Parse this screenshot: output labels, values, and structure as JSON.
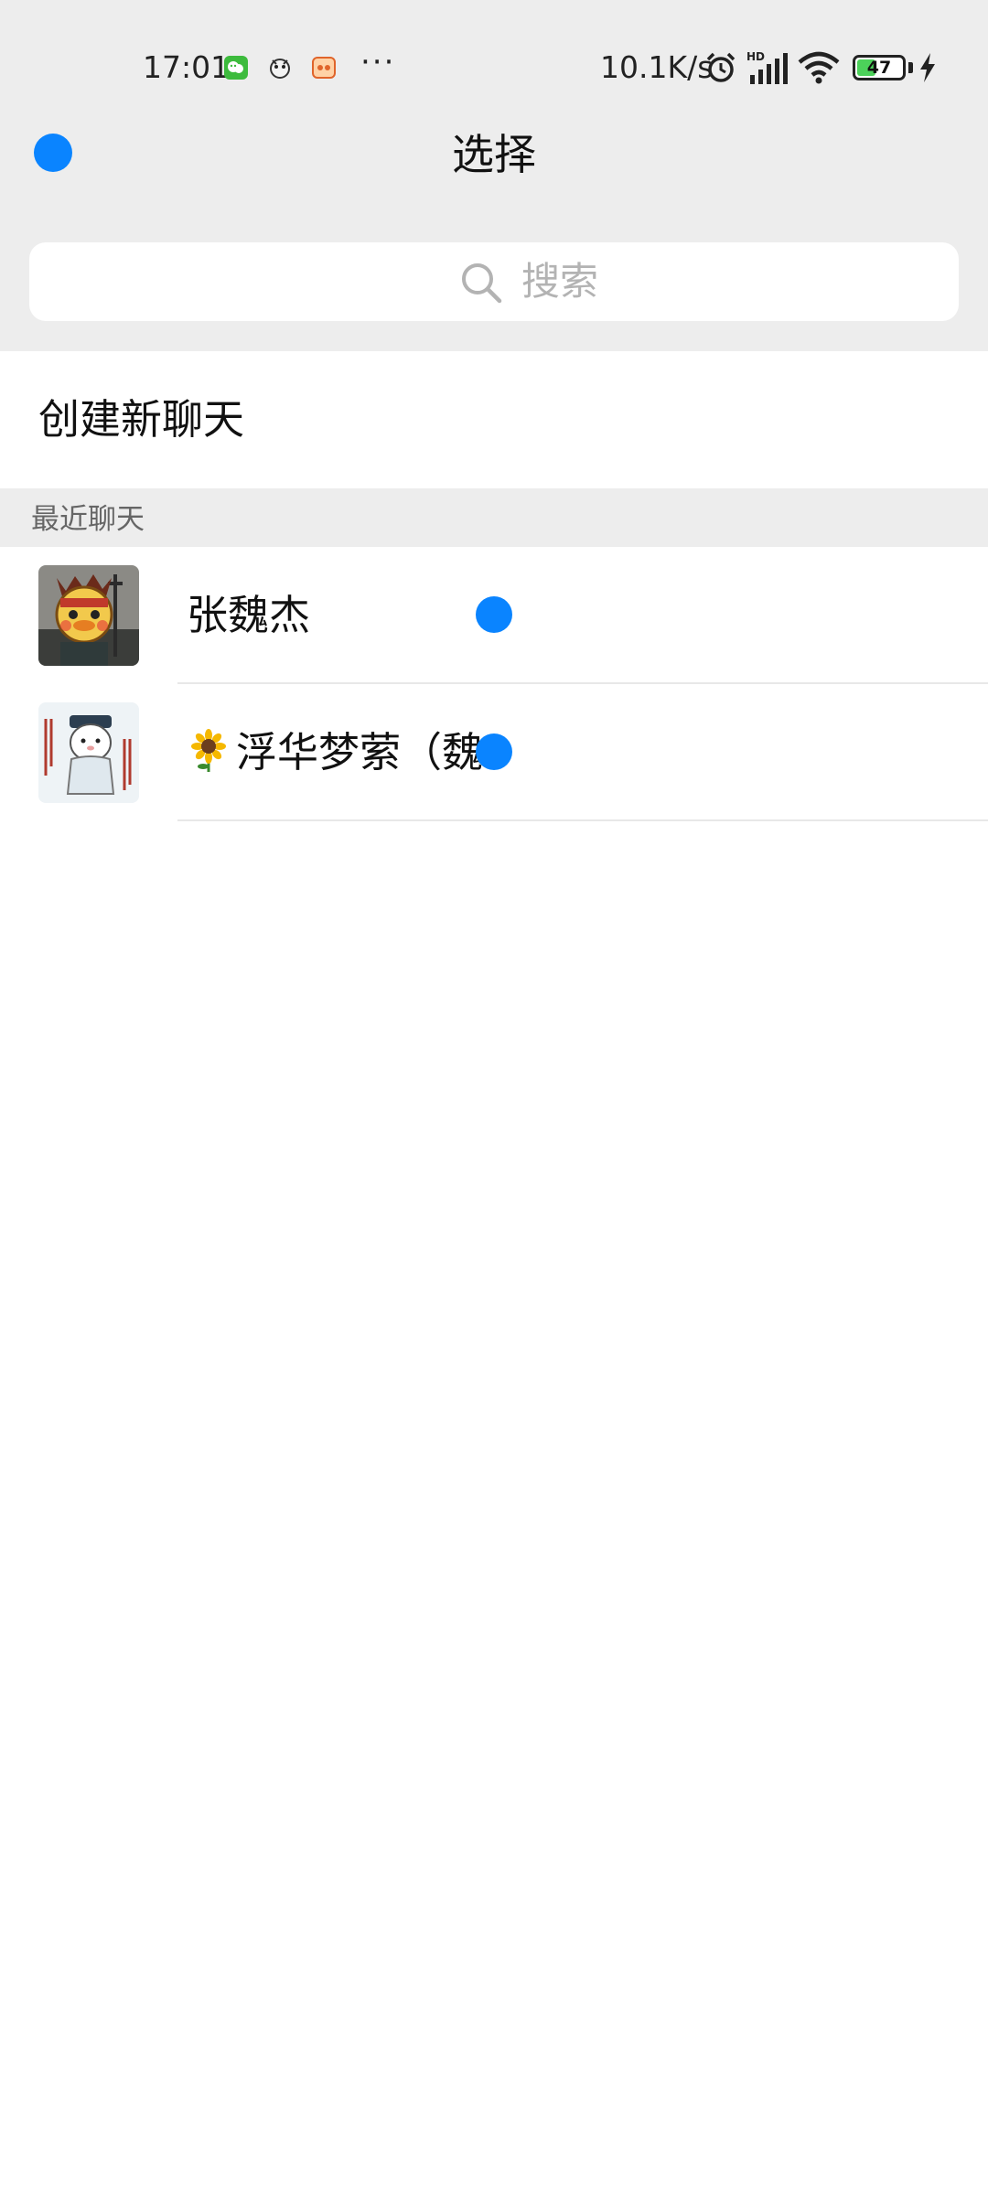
{
  "status_bar": {
    "time": "17:01",
    "more": "···",
    "net_speed": "10.1K/s",
    "battery_level": 47,
    "battery_text": "47",
    "icons": [
      "wechat-notification-icon",
      "cartoon-notification-icon",
      "game-notification-icon",
      "alarm-icon",
      "hd-signal-icon",
      "wifi-icon",
      "battery-icon",
      "charging-icon"
    ]
  },
  "header": {
    "title": "选择"
  },
  "search": {
    "placeholder": "搜索"
  },
  "create_chat": {
    "label": "创建新聊天"
  },
  "recent_section": {
    "label": "最近聊天"
  },
  "contacts": [
    {
      "name": "张魏杰",
      "emoji": ""
    },
    {
      "name": "浮华梦萦（魏",
      "emoji": "sunflower-icon"
    }
  ],
  "colors": {
    "accent": "#0a84ff",
    "top_background": "#ededed",
    "placeholder": "#b3b3b3"
  }
}
